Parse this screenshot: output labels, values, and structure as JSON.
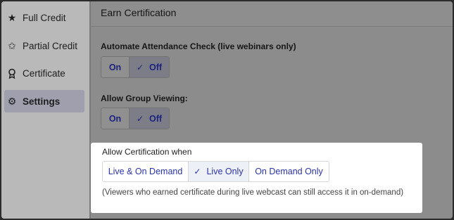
{
  "sidebar": {
    "items": [
      {
        "label": "Full Credit",
        "icon": "star-filled-icon"
      },
      {
        "label": "Partial Credit",
        "icon": "star-half-icon"
      },
      {
        "label": "Certificate",
        "icon": "ribbon-badge-icon"
      },
      {
        "label": "Settings",
        "icon": "gear-icon",
        "active": true
      }
    ]
  },
  "main": {
    "title": "Earn Certification",
    "automate": {
      "label": "Automate Attendance Check (live webinars only)",
      "on_label": "On",
      "off_label": "Off",
      "selected": "Off"
    },
    "group": {
      "label": "Allow Group Viewing:",
      "on_label": "On",
      "off_label": "Off",
      "selected": "Off"
    },
    "certification": {
      "label": "Allow Certification when",
      "options": [
        "Live & On Demand",
        "Live Only",
        "On Demand Only"
      ],
      "selected": "Live Only",
      "note": "(Viewers who earned certificate during live webcast can still access it in on-demand)"
    }
  },
  "colors": {
    "accent_text": "#2a33a8",
    "highlight_bg": "#ffffff",
    "overlay_dim": "#8c8c8c"
  }
}
